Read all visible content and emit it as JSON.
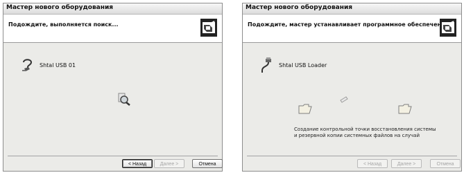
{
  "window_left": {
    "title": "Мастер нового оборудования",
    "header_text": "Подождите, выполняется поиск...",
    "device_name": "Shtal USB 01",
    "buttons": {
      "back": "< Назад",
      "next": "Далее >",
      "cancel": "Отмена"
    },
    "icons": [
      "wizard-hardware-icon",
      "unknown-device-icon",
      "searching-magnifier-icon"
    ]
  },
  "window_right": {
    "title": "Мастер нового оборудования",
    "header_text": "Подождите, мастер устанавливает программное обеспечение...",
    "device_name": "Shtal USB Loader",
    "status_line1": "Создание контрольной точки восстановления системы",
    "status_line2": "и резервной копии системных файлов на случай",
    "buttons": {
      "back": "< Назад",
      "next": "Далее >",
      "cancel": "Отмена"
    },
    "icons": [
      "wizard-hardware-icon",
      "usb-cable-icon",
      "folder-icon",
      "flying-document-icon",
      "folder-icon"
    ]
  }
}
